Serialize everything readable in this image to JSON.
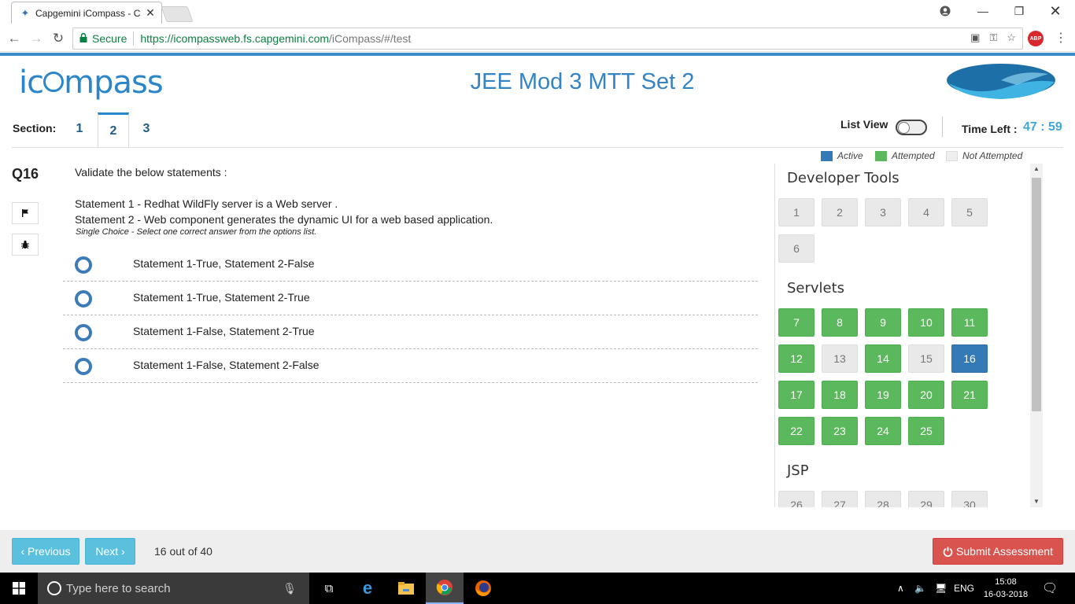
{
  "browser": {
    "tab_title": "Capgemini iCompass - C",
    "secure_label": "Secure",
    "url_host": "https://icompassweb.fs.capgemini.com",
    "url_path": "/iCompass/#/test",
    "abp_label": "ABP"
  },
  "header": {
    "logo_text_pre": "ic",
    "logo_text_post": "mpass",
    "title": "JEE Mod 3 MTT Set 2"
  },
  "sections": {
    "label": "Section:",
    "tabs": [
      "1",
      "2",
      "3"
    ],
    "active": "2"
  },
  "controls": {
    "list_view_label": "List View",
    "time_left_label": "Time Left :",
    "time_left_value": "47 : 59"
  },
  "question": {
    "number": "Q16",
    "prompt": "Validate the below statements :",
    "statement1": "Statement 1 - Redhat WildFly server is a Web server .",
    "statement2": "Statement 2 - Web component generates the dynamic UI for a web based application.",
    "hint": "Single Choice - Select one correct answer from the options list.",
    "options": [
      "Statement 1-True, Statement 2-False",
      "Statement 1-True, Statement 2-True",
      "Statement 1-False, Statement 2-True",
      "Statement 1-False, Statement 2-False"
    ]
  },
  "legend": {
    "active": "Active",
    "attempted": "Attempted",
    "not_attempted": "Not Attempted",
    "colors": {
      "active": "#337ab7",
      "attempted": "#5cb85c",
      "not_attempted": "#e9e9e9"
    }
  },
  "palette": {
    "groups": [
      {
        "title": "Developer Tools",
        "questions": [
          {
            "n": "1",
            "s": "na"
          },
          {
            "n": "2",
            "s": "na"
          },
          {
            "n": "3",
            "s": "na"
          },
          {
            "n": "4",
            "s": "na"
          },
          {
            "n": "5",
            "s": "na"
          },
          {
            "n": "6",
            "s": "na"
          }
        ]
      },
      {
        "title": "Servlets",
        "questions": [
          {
            "n": "7",
            "s": "att"
          },
          {
            "n": "8",
            "s": "att"
          },
          {
            "n": "9",
            "s": "att"
          },
          {
            "n": "10",
            "s": "att"
          },
          {
            "n": "11",
            "s": "att"
          },
          {
            "n": "12",
            "s": "att"
          },
          {
            "n": "13",
            "s": "na"
          },
          {
            "n": "14",
            "s": "att"
          },
          {
            "n": "15",
            "s": "na"
          },
          {
            "n": "16",
            "s": "act"
          },
          {
            "n": "17",
            "s": "att"
          },
          {
            "n": "18",
            "s": "att"
          },
          {
            "n": "19",
            "s": "att"
          },
          {
            "n": "20",
            "s": "att"
          },
          {
            "n": "21",
            "s": "att"
          },
          {
            "n": "22",
            "s": "att"
          },
          {
            "n": "23",
            "s": "att"
          },
          {
            "n": "24",
            "s": "att"
          },
          {
            "n": "25",
            "s": "att"
          }
        ]
      },
      {
        "title": "JSP",
        "questions": [
          {
            "n": "26",
            "s": "na"
          },
          {
            "n": "27",
            "s": "na"
          },
          {
            "n": "28",
            "s": "na"
          },
          {
            "n": "29",
            "s": "na"
          },
          {
            "n": "30",
            "s": "na"
          }
        ]
      }
    ]
  },
  "footer": {
    "previous_label": "‹ Previous",
    "next_label": "Next ›",
    "progress": "16 out of 40",
    "submit_label": "Submit Assessment"
  },
  "taskbar": {
    "search_placeholder": "Type here to search",
    "language": "ENG",
    "time": "15:08",
    "date": "16-03-2018"
  }
}
